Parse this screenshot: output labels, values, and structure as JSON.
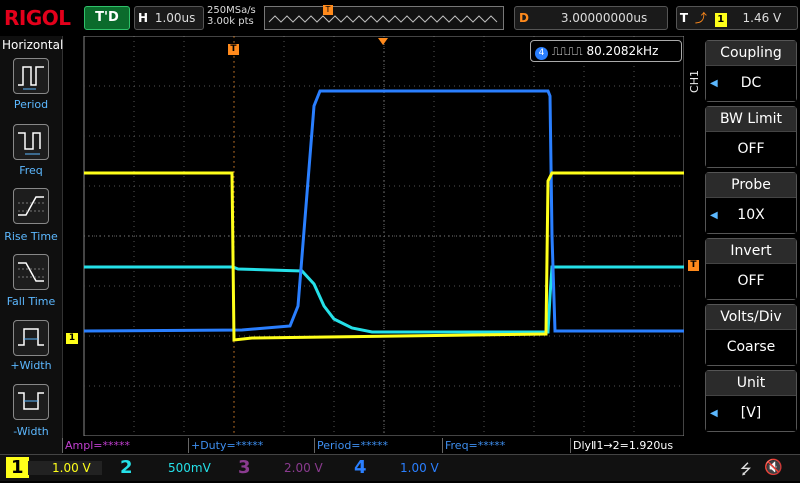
{
  "top": {
    "logo": "RIGOL",
    "trigger_status": "T'D",
    "horizontal_label": "H",
    "timebase": "1.00us",
    "sample_rate": "250MSa/s",
    "mem_depth": "3.00k pts",
    "delay_label": "D",
    "delay": "3.00000000us",
    "trigger_label": "T",
    "trigger_source": "1",
    "trigger_level": "1.46 V"
  },
  "left_panel": {
    "title": "Horizontal",
    "items": [
      {
        "label": "Period",
        "icon": "period-icon"
      },
      {
        "label": "Freq",
        "icon": "freq-icon"
      },
      {
        "label": "Rise Time",
        "icon": "rise-time-icon"
      },
      {
        "label": "Fall Time",
        "icon": "fall-time-icon"
      },
      {
        "label": "+Width",
        "icon": "pos-width-icon"
      },
      {
        "label": "-Width",
        "icon": "neg-width-icon"
      }
    ]
  },
  "freq_badge": {
    "channel": "4",
    "value": "80.2082kHz"
  },
  "right_panel": {
    "channel_tag": "CH1",
    "menus": [
      {
        "title": "Coupling",
        "value": "DC"
      },
      {
        "title": "BW Limit",
        "value": "OFF"
      },
      {
        "title": "Probe",
        "value": "10X"
      },
      {
        "title": "Invert",
        "value": "OFF"
      },
      {
        "title": "Volts/Div",
        "value": "Coarse"
      },
      {
        "title": "Unit",
        "value": "[V]"
      }
    ]
  },
  "measurements": [
    {
      "text": "Ampl=*****",
      "color": "#c23fd1"
    },
    {
      "text": "+Duty=*****",
      "color": "#3e8ff0"
    },
    {
      "text": "Period=*****",
      "color": "#3e8ff0"
    },
    {
      "text": "Freq=*****",
      "color": "#3e8ff0"
    },
    {
      "text": "DlyⅡ1→2=1.920us",
      "color": "#ffffff"
    }
  ],
  "channels": [
    {
      "num": "1",
      "scale": "1.00 V",
      "color": "#ffff1a"
    },
    {
      "num": "2",
      "scale": "500mV",
      "color": "#25e0e8"
    },
    {
      "num": "3",
      "scale": "2.00 V",
      "color": "#8a3b8f"
    },
    {
      "num": "4",
      "scale": "1.00 V",
      "color": "#2a7fff"
    }
  ],
  "markers": {
    "ch1": "1",
    "trigger": "T"
  },
  "colors": {
    "ch1": "#ffff1a",
    "ch2": "#25e0e8",
    "ch4": "#2a7fff",
    "trigger": "#ff8a1c"
  }
}
